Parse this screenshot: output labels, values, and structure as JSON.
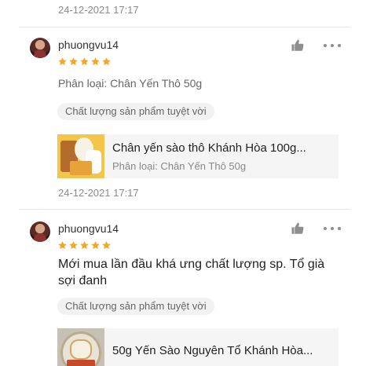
{
  "top_date": "24-12-2021 17:17",
  "colors": {
    "star": "#f5a623",
    "tag_bg": "#f2f2f2",
    "card_bg": "#f5f5f5",
    "divider": "#e6e6e6"
  },
  "reviews": [
    {
      "username": "phuongvu14",
      "rating": 5,
      "variant": "Phân loại: Chân Yến Thô 50g",
      "comment": "",
      "tag": "Chất lượng sản phẩm tuyệt vời",
      "product": {
        "name": "Chân yến sào thô Khánh Hòa 100g...",
        "variant": "Phân loại: Chân Yến Thô 50g"
      },
      "date": "24-12-2021 17:17"
    },
    {
      "username": "phuongvu14",
      "rating": 5,
      "comment": "Mới mua lần đầu khá ưng chất lượng sp. Tổ già sợi đanh",
      "tag": "Chất lượng sản phẩm tuyệt vời",
      "product": {
        "name": "50g Yến Sào Nguyên Tổ Khánh Hòa..."
      }
    }
  ],
  "icons": {
    "like": "thumbs-up-icon",
    "more": "more-dots-icon",
    "star": "star-icon"
  }
}
